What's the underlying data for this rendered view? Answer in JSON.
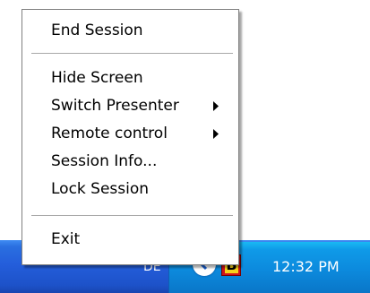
{
  "menu": {
    "items": [
      {
        "label": "End Session"
      },
      {
        "label": "Hide Screen"
      },
      {
        "label": "Switch Presenter",
        "submenu": true
      },
      {
        "label": "Remote control",
        "submenu": true
      },
      {
        "label": "Session Info..."
      },
      {
        "label": "Lock Session"
      },
      {
        "label": "Exit"
      }
    ]
  },
  "taskbar": {
    "language": "DE",
    "app_icon_letter": "B",
    "clock": "12:32 PM"
  },
  "colors": {
    "taskbar_blue": "#245edb",
    "tray_blue": "#0c8add",
    "menu_bg": "#ffffff"
  },
  "icons": [
    "chevron-left-icon",
    "app-b-icon",
    "submenu-arrow-icon"
  ]
}
